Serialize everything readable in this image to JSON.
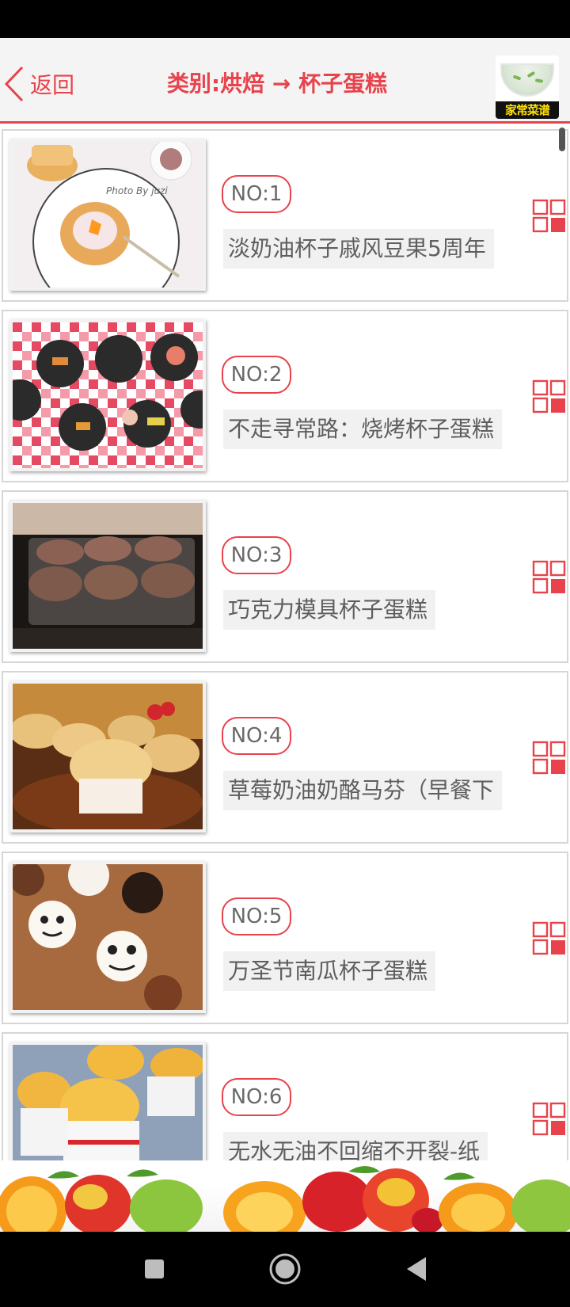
{
  "header": {
    "back_label": "返回",
    "title": "类别:烘焙 → 杯子蛋糕",
    "logo_text": "家常菜谱"
  },
  "colors": {
    "accent": "#e8434c",
    "text": "#5e5e5e",
    "card_border": "#d6d6d6"
  },
  "recipes": [
    {
      "no": "NO:1",
      "name": "淡奶油杯子戚风豆果5周年"
    },
    {
      "no": "NO:2",
      "name": "不走寻常路：烧烤杯子蛋糕"
    },
    {
      "no": "NO:3",
      "name": "巧克力模具杯子蛋糕"
    },
    {
      "no": "NO:4",
      "name": "草莓奶油奶酪马芬（早餐下"
    },
    {
      "no": "NO:5",
      "name": "万圣节南瓜杯子蛋糕"
    },
    {
      "no": "NO:6",
      "name": "无水无油不回缩不开裂-纸"
    }
  ],
  "icons": {
    "back": "chevron-left-icon",
    "grid": "grid-icon",
    "nav_recents": "square-icon",
    "nav_home": "circle-icon",
    "nav_back": "triangle-icon"
  }
}
